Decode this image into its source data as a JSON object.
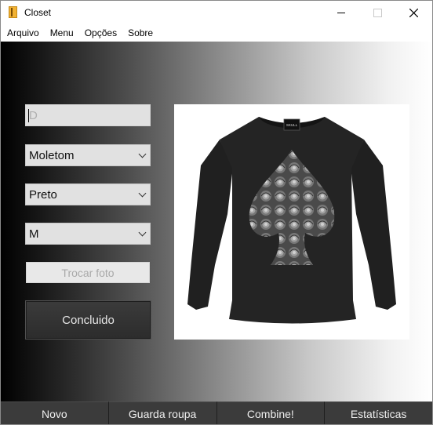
{
  "window": {
    "title": "Closet",
    "icon": "closet-app-icon"
  },
  "menubar": {
    "items": [
      "Arquivo",
      "Menu",
      "Opções",
      "Sobre"
    ]
  },
  "form": {
    "id_field": {
      "value": "",
      "placeholder": "D"
    },
    "type_select": {
      "value": "Moletom"
    },
    "color_select": {
      "value": "Preto"
    },
    "size_select": {
      "value": "M"
    },
    "change_photo_label": "Trocar foto",
    "done_label": "Concluido"
  },
  "photo": {
    "description": "Black long-sleeve shirt",
    "brand_tag": "SKULL"
  },
  "bottom_nav": {
    "tabs": [
      "Novo",
      "Guarda roupa",
      "Combine!",
      "Estatísticas"
    ]
  },
  "colors": {
    "accent_dark": "#3b3b3b"
  }
}
